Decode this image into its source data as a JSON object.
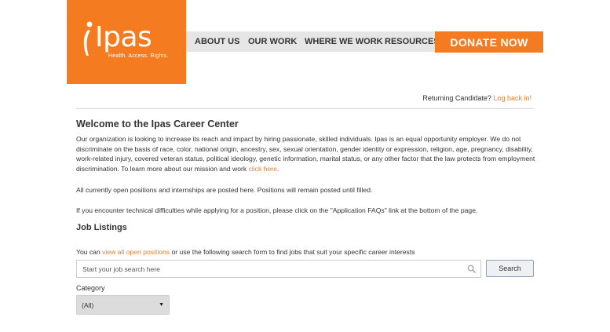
{
  "brand": {
    "name": "Ipas",
    "tagline": "Health. Access. Rights.",
    "color": "#f47b20"
  },
  "nav": {
    "items": [
      {
        "label": "ABOUT US"
      },
      {
        "label": "OUR WORK"
      },
      {
        "label": "WHERE WE WORK"
      },
      {
        "label": "RESOURCES"
      }
    ],
    "donate_label": "DONATE NOW"
  },
  "account": {
    "prompt": "Returning Candidate?",
    "login_link": "Log back in!"
  },
  "career": {
    "title": "Welcome to the Ipas Career Center",
    "intro": "Our organization is looking to increase its reach and impact by hiring passionate, skilled individuals. Ipas is an equal opportunity employer. We do not discriminate on the basis of race, color, national origin, ancestry, sex, sexual orientation, gender identity or expression, religion, age, pregnancy, disability, work-related injury, covered veteran status, political ideology, genetic information, marital status, or any other factor that the law protects from employment discrimination. To learn more about our mission and work",
    "intro_link": "click here",
    "intro_end": ".",
    "open_positions_text": "All currently open positions and internships are posted here. Positions will remain posted until filled.",
    "technical_text": "If you encounter technical difficulties while applying for a position, please click on the \"Application FAQs\" link at the bottom of the page."
  },
  "listings": {
    "title": "Job Listings",
    "search_prefix": "You can",
    "view_all_link": "view all open positions",
    "search_suffix": "or use the following search form to find jobs that suit your specific career interests",
    "search_placeholder": "Start your job search here",
    "search_value": "",
    "search_button": "Search",
    "search_icon": "search-icon",
    "category_label": "Category",
    "category_selected": "(All)"
  }
}
